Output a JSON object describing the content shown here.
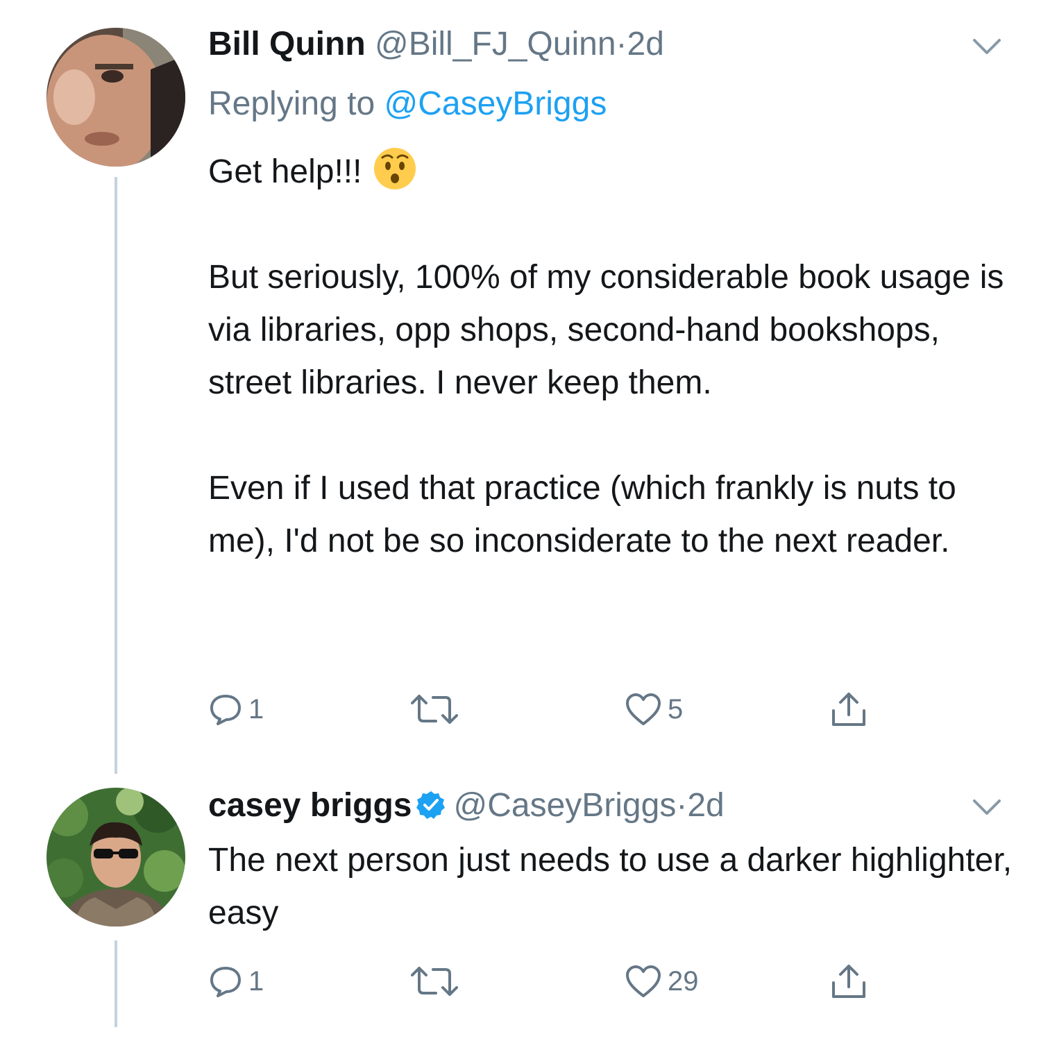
{
  "tweets": [
    {
      "display_name": "Bill Quinn",
      "handle": "@Bill_FJ_Quinn",
      "separator": "·",
      "time": "2d",
      "replying_prefix": "Replying to",
      "replying_handle": "@CaseyBriggs",
      "paragraphs": [
        "Get help!!!",
        "But seriously, 100% of my considerable book usage is via libraries, opp shops, second-hand bookshops, street libraries. I never keep them.",
        "Even if I used that practice (which frankly is nuts to me), I'd not be so inconsiderate to the next reader."
      ],
      "emoji": "hushed-face-emoji",
      "reply_count": "1",
      "retweet_count": "",
      "like_count": "5"
    },
    {
      "display_name": "casey briggs",
      "verified": true,
      "handle": "@CaseyBriggs",
      "separator": "·",
      "time": "2d",
      "paragraphs": [
        "The next person just needs to use a darker highlighter, easy"
      ],
      "reply_count": "1",
      "retweet_count": "",
      "like_count": "29"
    }
  ],
  "colors": {
    "text": "#14171a",
    "secondary": "#657786",
    "link": "#1da1f2",
    "thread_line": "#c4d2de"
  },
  "icons": [
    "reply-icon",
    "retweet-icon",
    "like-icon",
    "share-icon",
    "chevron-down-icon",
    "verified-badge-icon"
  ]
}
